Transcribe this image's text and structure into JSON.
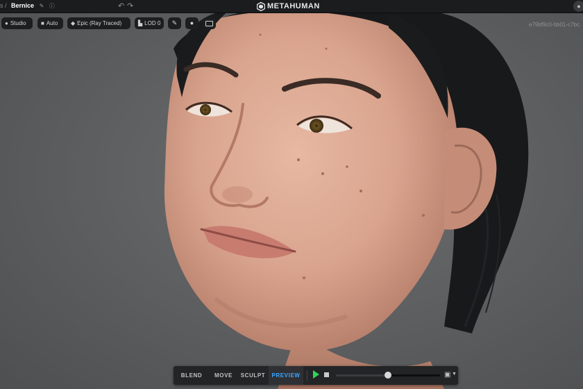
{
  "topbar": {
    "breadcrumb_sep": "s /",
    "project_name": "Bernice",
    "edit_icon": "pencil-icon",
    "help_icon": "help-circle-icon",
    "undo_icon": "undo-icon",
    "redo_icon": "redo-icon",
    "logo_text": "METAHUMAN",
    "logo_icon": "metahuman-hex-icon",
    "corner_icon": "account-icon"
  },
  "viewport_toolbar": {
    "lighting": {
      "label": "Studio",
      "icon": "lightbulb-icon"
    },
    "camera": {
      "label": "Auto",
      "icon": "video-camera-icon"
    },
    "quality": {
      "label": "Epic (Ray Traced)",
      "icon": "diamond-icon"
    },
    "lod": {
      "label": "LOD 0",
      "icon": "lod-icon"
    },
    "tool1_icon": "brush-icon",
    "tool2_icon": "speech-icon",
    "tool3_icon": "display-icon"
  },
  "character_id": "e79bf9c0-bb01-c7bc",
  "mode_dock": {
    "tabs": [
      "BLEND",
      "MOVE",
      "SCULPT",
      "PREVIEW"
    ],
    "active_tab": "PREVIEW",
    "play_icon": "play-icon",
    "stop_icon": "stop-icon",
    "timeline_position": 0.5,
    "camera_icon": "film-camera-icon",
    "dropdown_icon": "chevron-down-icon"
  },
  "colors": {
    "accent": "#3aa7ff",
    "play": "#2fd35a",
    "toolbar_bg": "#1d1e20",
    "viewport_bg": "#5c5d5f"
  }
}
